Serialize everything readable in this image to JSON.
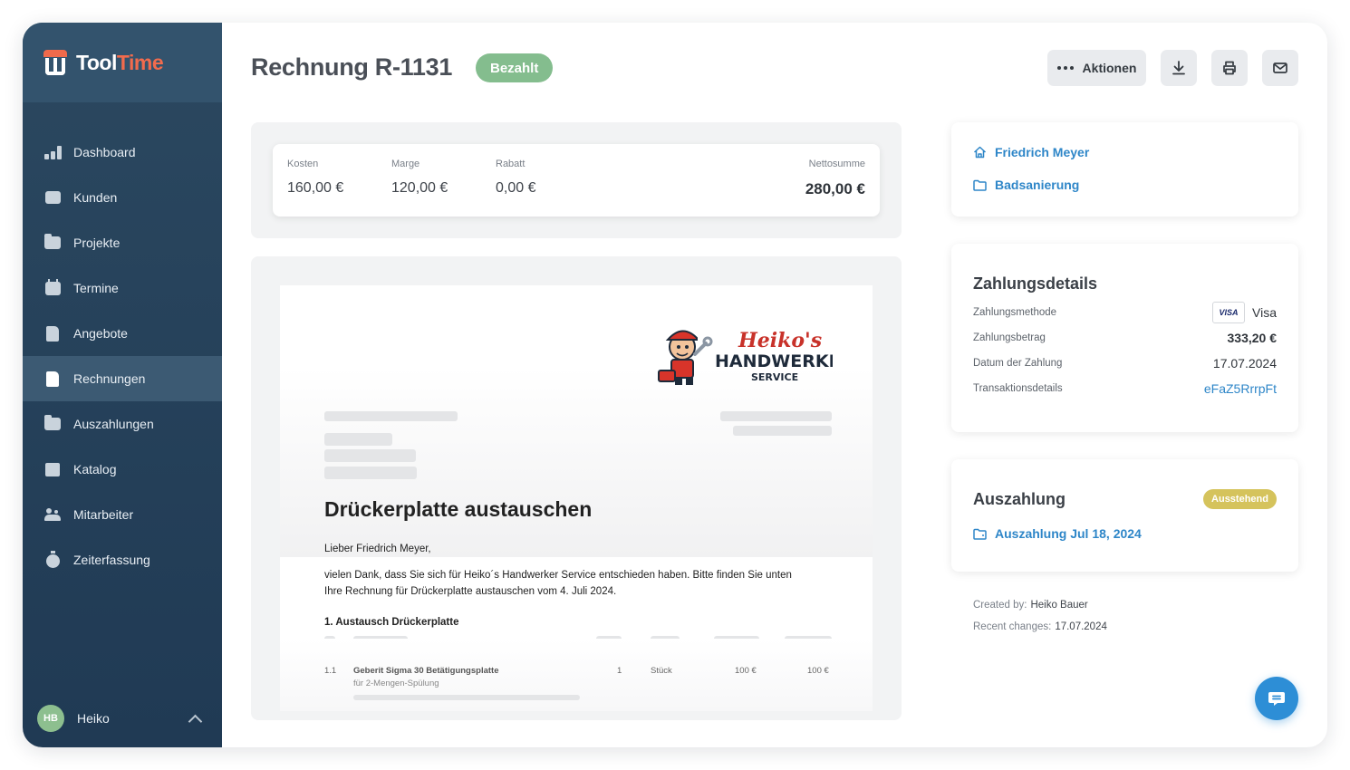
{
  "app": {
    "logo_part1": "Tool",
    "logo_part2": "Time"
  },
  "sidebar": {
    "items": [
      {
        "label": "Dashboard",
        "icon": "chart-icon"
      },
      {
        "label": "Kunden",
        "icon": "contacts-icon"
      },
      {
        "label": "Projekte",
        "icon": "folder-icon"
      },
      {
        "label": "Termine",
        "icon": "calendar-icon"
      },
      {
        "label": "Angebote",
        "icon": "document-icon"
      },
      {
        "label": "Rechnungen",
        "icon": "invoice-icon",
        "active": true
      },
      {
        "label": "Auszahlungen",
        "icon": "wallet-icon"
      },
      {
        "label": "Katalog",
        "icon": "book-icon"
      },
      {
        "label": "Mitarbeiter",
        "icon": "people-icon"
      },
      {
        "label": "Zeiterfassung",
        "icon": "stopwatch-icon"
      }
    ],
    "user": {
      "initials": "HB",
      "name": "Heiko"
    }
  },
  "header": {
    "title": "Rechnung R-1131",
    "status": "Bezahlt",
    "actions_label": "Aktionen"
  },
  "totals": {
    "kosten_label": "Kosten",
    "kosten": "160,00 €",
    "marge_label": "Marge",
    "marge": "120,00 €",
    "rabatt_label": "Rabatt",
    "rabatt": "0,00 €",
    "netto_label": "Nettosumme",
    "netto": "280,00 €"
  },
  "document": {
    "logo_line1": "Heiko's",
    "logo_line2": "HANDWERKER",
    "logo_line3": "SERVICE",
    "title": "Drückerplatte austauschen",
    "greeting": "Lieber Friedrich Meyer,",
    "body_line1": "vielen Dank, dass Sie sich für Heiko´s Handwerker Service entschieden haben. Bitte finden Sie unten",
    "body_line2": "Ihre Rechnung für Drückerplatte austauschen vom 4. Juli 2024.",
    "section": "1. Austausch Drückerplatte",
    "row": {
      "pos": "1.1",
      "name": "Geberit Sigma 30 Betätigungsplatte",
      "sub": "für 2-Mengen-Spülung",
      "qty": "1",
      "unit": "Stück",
      "price": "100 €",
      "total": "100 €"
    }
  },
  "customer_card": {
    "customer": "Friedrich Meyer",
    "project": "Badsanierung"
  },
  "payment": {
    "title": "Zahlungsdetails",
    "method_label": "Zahlungsmethode",
    "method_brand": "VISA",
    "method": "Visa",
    "amount_label": "Zahlungsbetrag",
    "amount": "333,20 €",
    "date_label": "Datum der Zahlung",
    "date": "17.07.2024",
    "txn_label": "Transaktionsdetails",
    "txn": "eFaZ5RrrpFt"
  },
  "payout": {
    "title": "Auszahlung",
    "status": "Ausstehend",
    "link": "Auszahlung Jul 18, 2024"
  },
  "meta": {
    "created_label": "Created by:",
    "created_by": "Heiko Bauer",
    "changed_label": "Recent changes:",
    "changed": "17.07.2024"
  },
  "colors": {
    "accent": "#2e86c8",
    "paid": "#84bd8e",
    "pending": "#d5c35c",
    "sidebar": "#203a54",
    "brand": "#f26b4d"
  }
}
